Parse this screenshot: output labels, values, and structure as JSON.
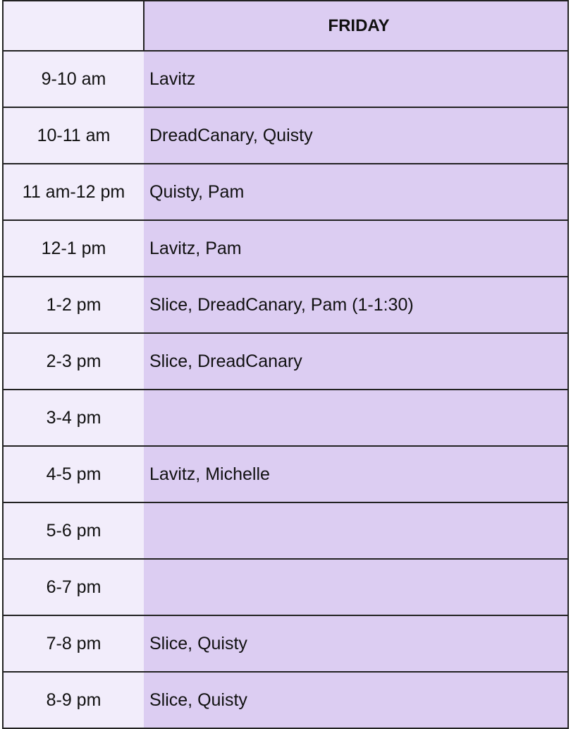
{
  "table": {
    "corner_label": "",
    "day_header": "FRIDAY",
    "rows": [
      {
        "time": "9-10 am",
        "names": "Lavitz"
      },
      {
        "time": "10-11 am",
        "names": "DreadCanary, Quisty"
      },
      {
        "time": "11 am-12 pm",
        "names": "Quisty, Pam"
      },
      {
        "time": "12-1 pm",
        "names": "Lavitz, Pam"
      },
      {
        "time": "1-2 pm",
        "names": "Slice, DreadCanary, Pam (1-1:30)"
      },
      {
        "time": "2-3 pm",
        "names": "Slice, DreadCanary"
      },
      {
        "time": "3-4 pm",
        "names": ""
      },
      {
        "time": "4-5 pm",
        "names": "Lavitz, Michelle"
      },
      {
        "time": "5-6 pm",
        "names": ""
      },
      {
        "time": "6-7 pm",
        "names": ""
      },
      {
        "time": "7-8 pm",
        "names": "Slice, Quisty"
      },
      {
        "time": "8-9 pm",
        "names": "Slice, Quisty"
      }
    ]
  },
  "colors": {
    "time_column_bg": "#f2edfb",
    "day_column_bg": "#dccdf2",
    "border": "#222222"
  }
}
